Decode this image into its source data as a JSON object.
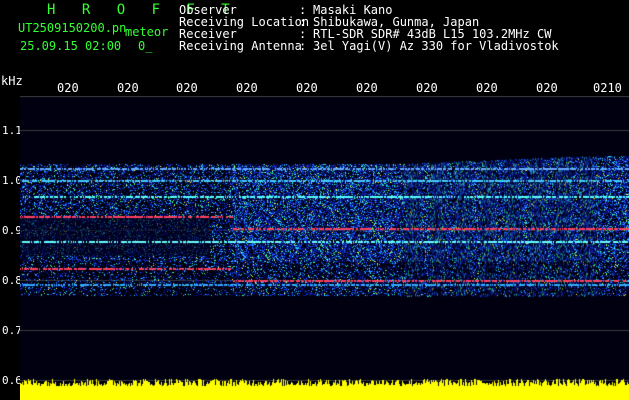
{
  "header": {
    "title": "H R O F F T",
    "filename": "UT2509150200.pn",
    "mode": "meteor",
    "datetime": "25.09.15 02:00",
    "counter": "0_",
    "fields": [
      {
        "label": "Observer",
        "sep": ":",
        "value": "Masaki Kano"
      },
      {
        "label": "Receiving Location",
        "sep": ":",
        "value": "Shibukawa, Gunma, Japan"
      },
      {
        "label": "Receiver",
        "sep": ":",
        "value": "RTL-SDR SDR# 43dB L15 103.2MHz CW"
      },
      {
        "label": "Receiving Antenna",
        "sep": ":",
        "value": "3el Yagi(V) Az 330 for Vladivostok"
      }
    ]
  },
  "axis": {
    "unit": "kHz",
    "y_ticks": [
      "1.1",
      "1.0",
      "0.9",
      "0.8",
      "0.7",
      "0.6"
    ],
    "x_ticks": [
      "020",
      "020",
      "020",
      "020",
      "020",
      "020",
      "020",
      "020",
      "020",
      "0210"
    ]
  },
  "colors": {
    "text_accent": "#33ff33",
    "background": "#000000",
    "noise": "#ffff00"
  }
}
